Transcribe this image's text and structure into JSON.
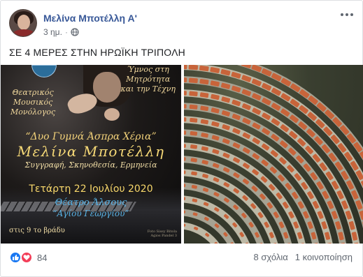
{
  "post": {
    "author": "Μελίνα Μποτέλλη Α'",
    "time": "3 ημ.",
    "privacy_icon": "globe-icon",
    "menu_icon": "more-options-icon",
    "caption": "ΣΕ 4 ΜΕΡΕΣ ΣΤΗΝ ΗΡΩΪΚΗ ΤΡΙΠΟΛΗ"
  },
  "poster": {
    "top_right": [
      "Ύμνος στη",
      "Μητρότητα",
      "και την Τέχνη"
    ],
    "left_col": [
      "Θεατρικός",
      "Μουσικός",
      "Μονόλογος"
    ],
    "title": "“Δυο Γυμνά Άσπρα Χέρια”",
    "name": "Μελίνα Μποτέλλη",
    "roles": "Συγγραφή, Σκηνοθεσία, Ερμηνεία",
    "date": "Τετάρτη 22 Ιουλίου 2020",
    "venue": "Θέατρο Άλσους",
    "venue2": "“Αγίου Γεωργίου”",
    "time": "στις 9 το βράδυ",
    "credit": [
      "Foto Sissy Bitola",
      "Agios Pandel 3"
    ]
  },
  "footer": {
    "reaction_icons": [
      "like-icon",
      "love-icon"
    ],
    "reaction_count": "84",
    "comments": "8 σχόλια",
    "shares": "1 κοινοποίηση"
  },
  "colors": {
    "author_link": "#385898",
    "like": "#1877f2",
    "love": "#f33e58",
    "poster_gold": "#f6d977",
    "poster_blue": "#58b3e6"
  }
}
